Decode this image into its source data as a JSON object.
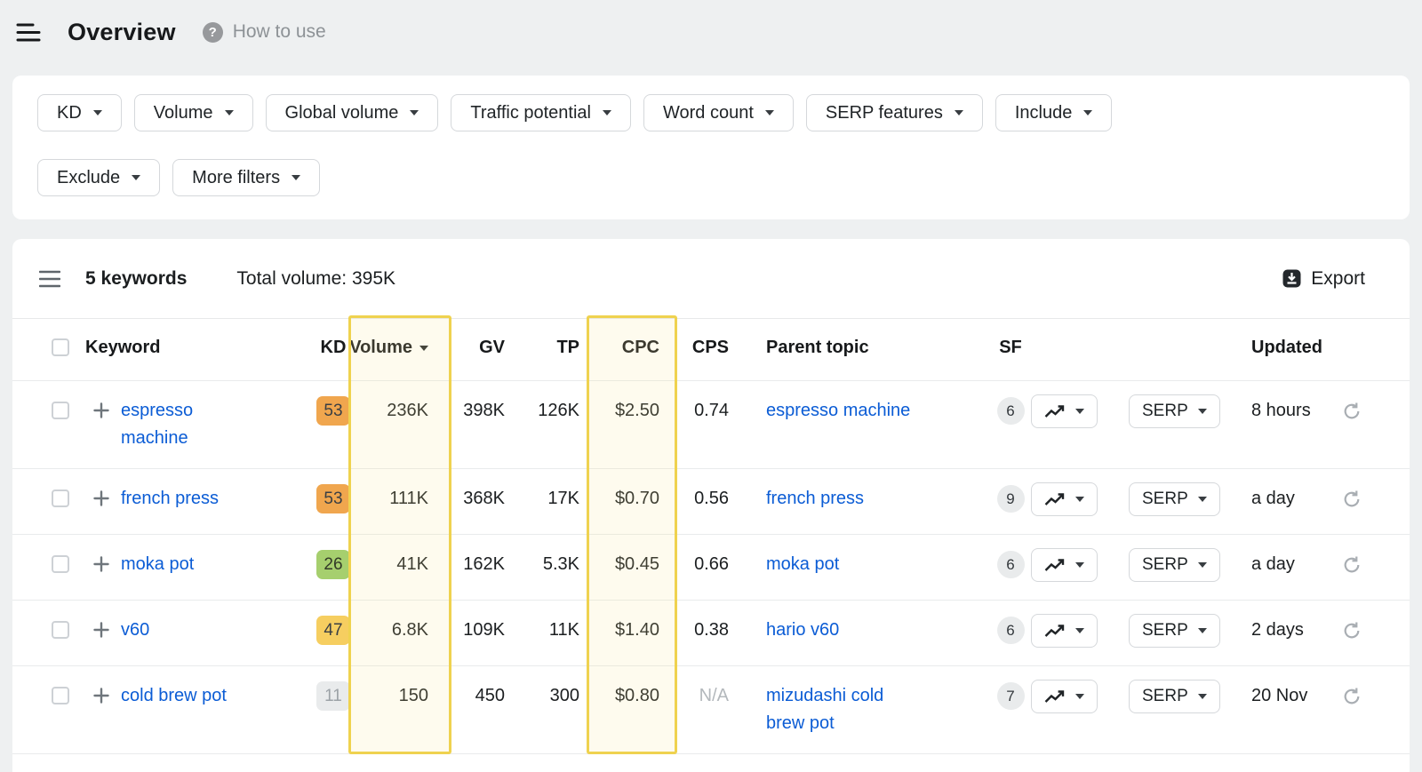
{
  "header": {
    "title": "Overview",
    "help_glyph": "?",
    "help_label": "How to use"
  },
  "filters": {
    "row1": [
      "KD",
      "Volume",
      "Global volume",
      "Traffic potential",
      "Word count",
      "SERP features",
      "Include"
    ],
    "row2": [
      "Exclude",
      "More filters"
    ]
  },
  "toolbar": {
    "count": "5 keywords",
    "total": "Total volume: 395K",
    "export_label": "Export"
  },
  "table": {
    "headers": {
      "keyword": "Keyword",
      "kd": "KD",
      "volume": "Volume",
      "gv": "GV",
      "tp": "TP",
      "cpc": "CPC",
      "cps": "CPS",
      "parent": "Parent topic",
      "sf": "SF",
      "updated": "Updated"
    },
    "serp_label": "SERP",
    "sort_column": "Volume",
    "highlighted_columns": [
      "Volume",
      "CPC"
    ],
    "highlight": {
      "border": "#efd24f",
      "fill": "rgba(249,233,147,0.16)"
    },
    "rows": [
      {
        "keyword": "espresso machine",
        "kd": "53",
        "kd_bg": "#f0a64e",
        "kd_text": "#3a3f44",
        "volume": "236K",
        "gv": "398K",
        "tp": "126K",
        "cpc": "$2.50",
        "cps": "0.74",
        "cps_color": "#1b1e20",
        "parent": "espresso machine",
        "sf": "6",
        "updated": "8 hours"
      },
      {
        "keyword": "french press",
        "kd": "53",
        "kd_bg": "#f0a64e",
        "kd_text": "#3a3f44",
        "volume": "111K",
        "gv": "368K",
        "tp": "17K",
        "cpc": "$0.70",
        "cps": "0.56",
        "cps_color": "#1b1e20",
        "parent": "french press",
        "sf": "9",
        "updated": "a day"
      },
      {
        "keyword": "moka pot",
        "kd": "26",
        "kd_bg": "#a6cf6e",
        "kd_text": "#333a28",
        "volume": "41K",
        "gv": "162K",
        "tp": "5.3K",
        "cpc": "$0.45",
        "cps": "0.66",
        "cps_color": "#1b1e20",
        "parent": "moka pot",
        "sf": "6",
        "updated": "a day"
      },
      {
        "keyword": "v60",
        "kd": "47",
        "kd_bg": "#f6ce60",
        "kd_text": "#3a3f44",
        "volume": "6.8K",
        "gv": "109K",
        "tp": "11K",
        "cpc": "$1.40",
        "cps": "0.38",
        "cps_color": "#1b1e20",
        "parent": "hario v60",
        "sf": "6",
        "updated": "2 days"
      },
      {
        "keyword": "cold brew pot",
        "kd": "11",
        "kd_bg": "#e9ebec",
        "kd_text": "#9ca2a7",
        "volume": "150",
        "gv": "450",
        "tp": "300",
        "cpc": "$0.80",
        "cps": "N/A",
        "cps_color": "#b3b8bc",
        "parent": "mizudashi cold brew pot",
        "sf": "7",
        "updated": "20 Nov"
      }
    ]
  }
}
